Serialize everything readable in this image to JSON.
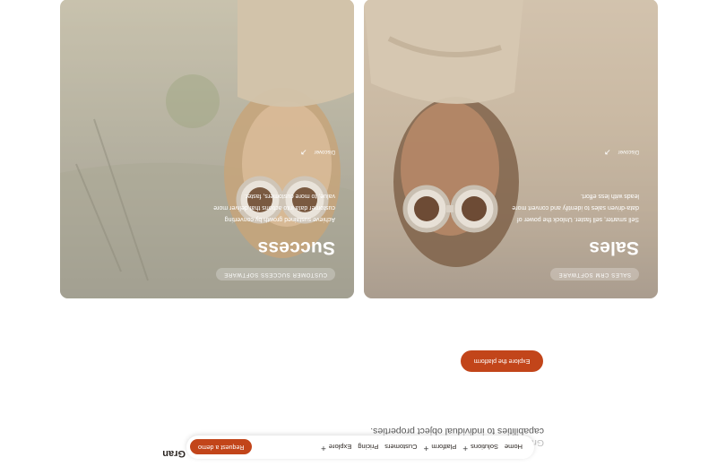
{
  "brand": {
    "logo_text": "Gran"
  },
  "nav": {
    "items": [
      {
        "label": "Home",
        "has_plus": false
      },
      {
        "label": "Solutions",
        "has_plus": true
      },
      {
        "label": "Platform",
        "has_plus": true
      },
      {
        "label": "Customers",
        "has_plus": false
      },
      {
        "label": "Pricing",
        "has_plus": false
      },
      {
        "label": "Explore",
        "has_plus": true
      }
    ],
    "cta_label": "Request a demo"
  },
  "intro": {
    "line1": "Gran",
    "line2": "capabilities to individual object properties.",
    "cta_label": "Explore the platform"
  },
  "cards": {
    "sales": {
      "pill": "SALES CRM SOFTWARE",
      "title": "Sales",
      "description": "Sell smarter, sell faster. Unlock the power of data-driven sales to identify and convert more leads with less effort.",
      "discover_label": "Discover"
    },
    "success": {
      "pill": "CUSTOMER SUCCESS SOFTWARE",
      "title": "Success",
      "description": "Achieve sustained growth by converting customer data into actions that deliver more value, to more customers, faster.",
      "discover_label": "Discover"
    }
  },
  "colors": {
    "accent": "#c2451a",
    "card_text": "#ffffff"
  }
}
